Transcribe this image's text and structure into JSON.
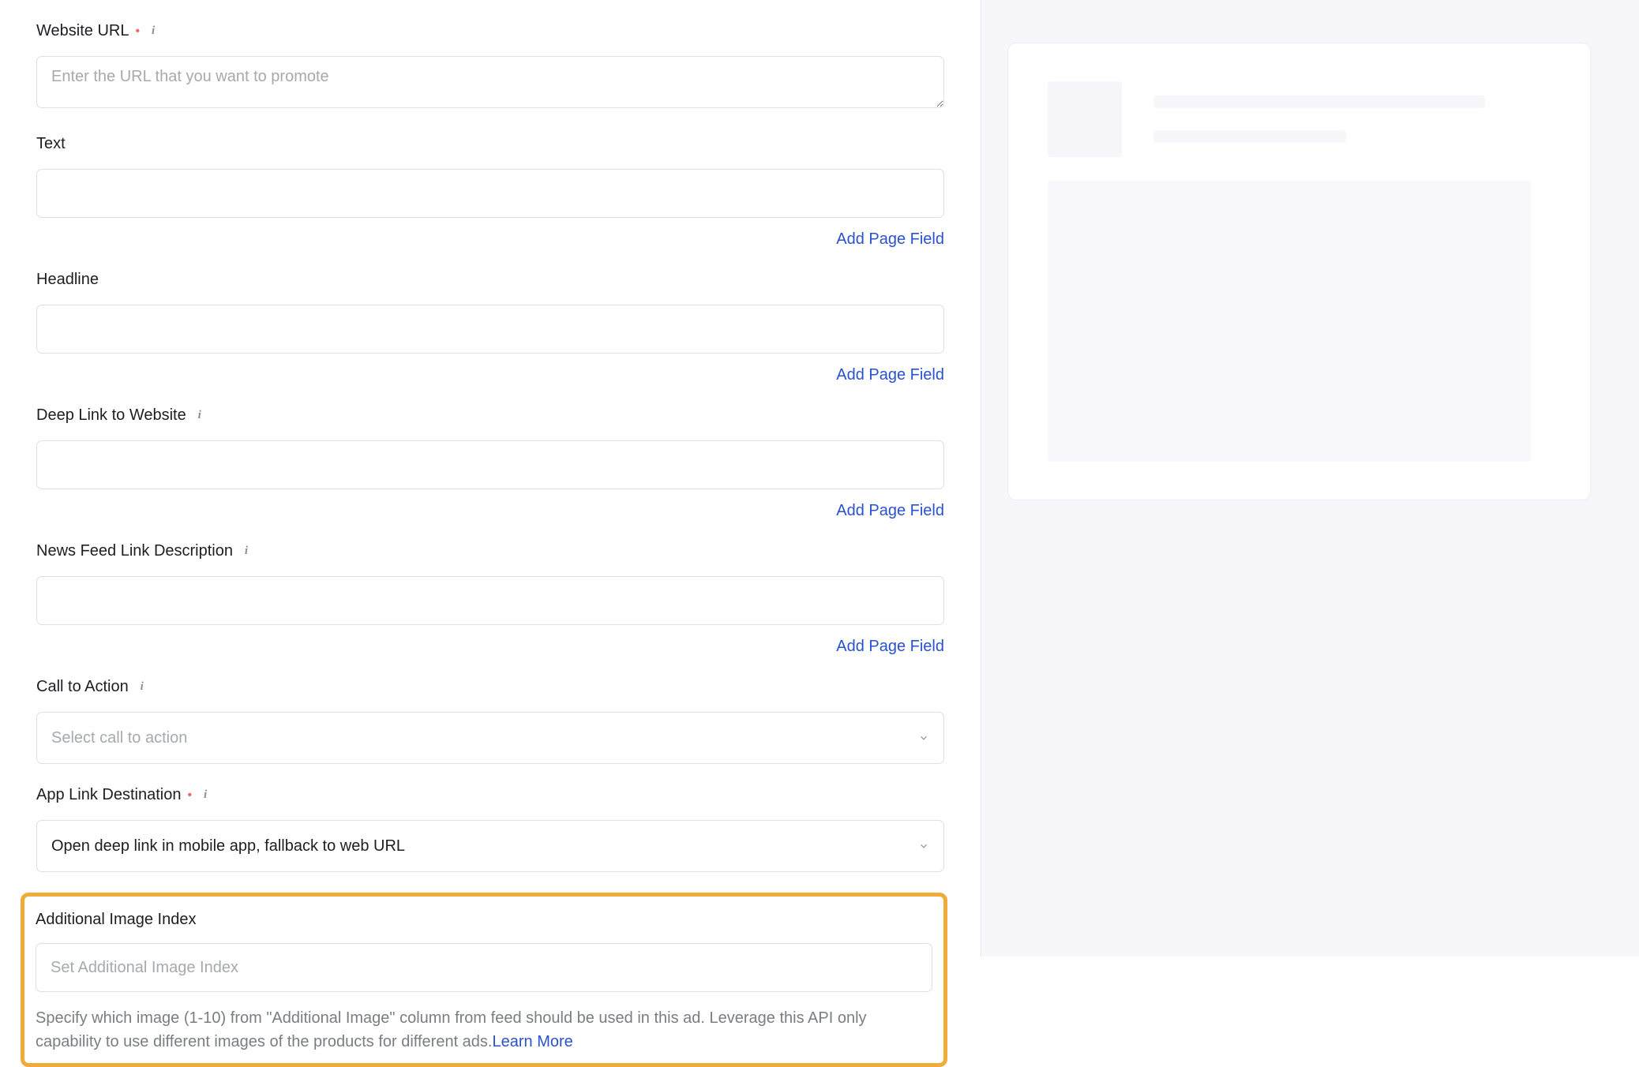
{
  "fields": {
    "website_url": {
      "label": "Website URL",
      "required": true,
      "info": true,
      "placeholder": "Enter the URL that you want to promote"
    },
    "text": {
      "label": "Text",
      "add_page_field": "Add Page Field"
    },
    "headline": {
      "label": "Headline",
      "add_page_field": "Add Page Field"
    },
    "deep_link": {
      "label": "Deep Link to Website",
      "info": true,
      "add_page_field": "Add Page Field"
    },
    "news_feed_desc": {
      "label": "News Feed Link Description",
      "info": true,
      "add_page_field": "Add Page Field"
    },
    "cta": {
      "label": "Call to Action",
      "info": true,
      "placeholder": "Select call to action"
    },
    "app_link_dest": {
      "label": "App Link Destination",
      "required": true,
      "info": true,
      "value": "Open deep link in mobile app, fallback to web URL"
    },
    "additional_image_index": {
      "label": "Additional Image Index",
      "placeholder": "Set Additional Image Index",
      "help": "Specify which image (1-10) from \"Additional Image\" column from feed should be used in this ad. Leverage this API only capability to use different images of the products for different ads.",
      "learn_more": "Learn More"
    }
  }
}
